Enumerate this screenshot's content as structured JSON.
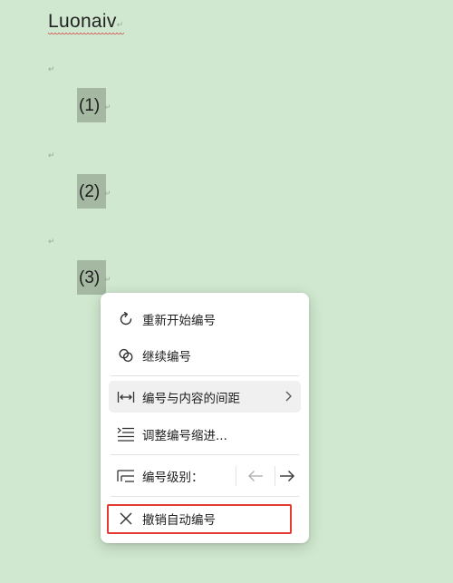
{
  "document": {
    "title": "Luonaiv",
    "paragraph_mark": "↵",
    "numbered_items": [
      "(1)",
      "(2)",
      "(3)"
    ]
  },
  "context_menu": {
    "items": [
      {
        "label": "重新开始编号",
        "icon": "restart-icon"
      },
      {
        "label": "继续编号",
        "icon": "link-icon"
      },
      {
        "label": "编号与内容的间距",
        "icon": "spacing-icon",
        "has_submenu": true
      },
      {
        "label": "调整编号缩进...",
        "icon": "indent-icon"
      },
      {
        "label": "编号级别：",
        "icon": "level-icon"
      },
      {
        "label": "撤销自动编号",
        "icon": "close-icon"
      }
    ]
  },
  "colors": {
    "page_background": "#d0e8cf",
    "number_highlight": "#a4b8a2",
    "annotation_box": "#e23b32"
  }
}
